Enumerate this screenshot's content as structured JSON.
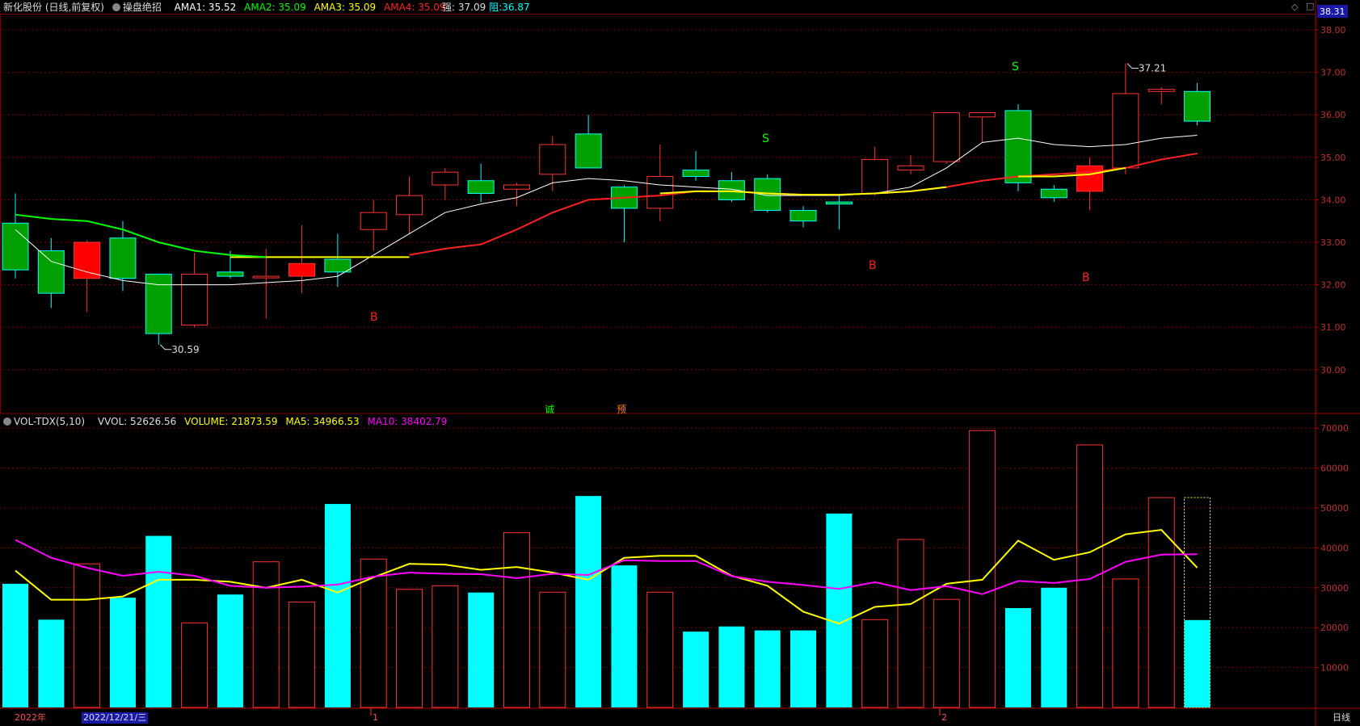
{
  "price_header": {
    "stock": "新化股份 (日线,前复权)",
    "indicator": "操盘绝招",
    "ama1": "AMA1: 35.52",
    "ama2": "AMA2: 35.09",
    "ama3": "AMA3: 35.09",
    "ama4": "AMA4: 35.09",
    "strong": "强: 37.09",
    "resist_label": "阻:",
    "resist_value": "36.87"
  },
  "vol_header": {
    "indicator": "VOL-TDX(5,10)",
    "vvol": "VVOL: 52626.56",
    "volume": "VOLUME: 21873.59",
    "ma5": "MA5: 34966.53",
    "ma10": "MA10: 38402.79"
  },
  "price_axis": {
    "current": "38.31",
    "ticks": [
      "38.00",
      "37.00",
      "36.00",
      "35.00",
      "34.00",
      "33.00",
      "32.00",
      "31.00",
      "30.00"
    ]
  },
  "volume_axis": {
    "ticks": [
      "70000",
      "60000",
      "50000",
      "40000",
      "30000",
      "20000",
      "10000"
    ]
  },
  "time_axis": {
    "year": "2022年",
    "selected_date": "2022/12/21/三",
    "month_marks": [
      "1",
      "2"
    ],
    "period": "日线"
  },
  "annotations": {
    "low": "30.59",
    "high": "37.21",
    "signals": [
      "B",
      "S",
      "B",
      "S",
      "B"
    ],
    "chars": [
      "诚",
      "预"
    ]
  },
  "colors": {
    "up": "#ff3232",
    "down": "#00a000",
    "volume_down": "#00ffff",
    "ma_white": "#ffffff",
    "ma_red": "#ff2020",
    "ma_yellow": "#ffff00",
    "ma_green": "#00ff00",
    "ma10": "#ff00ff",
    "grid": "#800000"
  },
  "chart_data": {
    "type": "candlestick",
    "candles": [
      {
        "o": 33.45,
        "h": 34.15,
        "l": 32.15,
        "c": 32.35
      },
      {
        "o": 32.8,
        "h": 33.1,
        "l": 31.45,
        "c": 31.8
      },
      {
        "o": 32.15,
        "h": 33.05,
        "l": 31.35,
        "c": 33.0
      },
      {
        "o": 33.1,
        "h": 33.5,
        "l": 31.85,
        "c": 32.15
      },
      {
        "o": 32.25,
        "h": 32.25,
        "l": 30.59,
        "c": 30.85
      },
      {
        "o": 31.05,
        "h": 32.75,
        "l": 31.0,
        "c": 32.25
      },
      {
        "o": 32.3,
        "h": 32.8,
        "l": 32.15,
        "c": 32.2
      },
      {
        "o": 32.2,
        "h": 32.85,
        "l": 31.2,
        "c": 32.2
      },
      {
        "o": 32.2,
        "h": 33.4,
        "l": 31.8,
        "c": 32.5
      },
      {
        "o": 32.6,
        "h": 33.2,
        "l": 31.95,
        "c": 32.3
      },
      {
        "o": 33.3,
        "h": 34.0,
        "l": 32.8,
        "c": 33.7
      },
      {
        "o": 33.65,
        "h": 34.55,
        "l": 33.2,
        "c": 34.1
      },
      {
        "o": 34.35,
        "h": 34.75,
        "l": 34.0,
        "c": 34.65
      },
      {
        "o": 34.45,
        "h": 34.85,
        "l": 33.95,
        "c": 34.15
      },
      {
        "o": 34.25,
        "h": 34.4,
        "l": 33.85,
        "c": 34.35
      },
      {
        "o": 34.6,
        "h": 35.5,
        "l": 34.2,
        "c": 35.3
      },
      {
        "o": 35.55,
        "h": 36.0,
        "l": 34.75,
        "c": 34.75
      },
      {
        "o": 34.3,
        "h": 34.35,
        "l": 33.0,
        "c": 33.8
      },
      {
        "o": 33.8,
        "h": 35.3,
        "l": 33.5,
        "c": 34.55
      },
      {
        "o": 34.7,
        "h": 35.15,
        "l": 34.45,
        "c": 34.55
      },
      {
        "o": 34.45,
        "h": 34.65,
        "l": 33.95,
        "c": 34.0
      },
      {
        "o": 34.5,
        "h": 34.6,
        "l": 33.7,
        "c": 33.75
      },
      {
        "o": 33.75,
        "h": 33.85,
        "l": 33.35,
        "c": 33.5
      },
      {
        "o": 33.95,
        "h": 34.1,
        "l": 33.3,
        "c": 33.9
      },
      {
        "o": 34.15,
        "h": 35.25,
        "l": 34.1,
        "c": 34.95
      },
      {
        "o": 34.7,
        "h": 35.05,
        "l": 34.6,
        "c": 34.8
      },
      {
        "o": 34.9,
        "h": 36.05,
        "l": 34.85,
        "c": 36.05
      },
      {
        "o": 35.95,
        "h": 36.05,
        "l": 35.35,
        "c": 36.05
      },
      {
        "o": 36.1,
        "h": 36.25,
        "l": 34.2,
        "c": 34.4
      },
      {
        "o": 34.25,
        "h": 34.35,
        "l": 33.95,
        "c": 34.05
      },
      {
        "o": 34.2,
        "h": 35.0,
        "l": 33.75,
        "c": 34.8
      },
      {
        "o": 34.75,
        "h": 37.21,
        "l": 34.6,
        "c": 36.5
      },
      {
        "o": 36.55,
        "h": 36.65,
        "l": 36.25,
        "c": 36.6
      },
      {
        "o": 36.55,
        "h": 36.75,
        "l": 35.75,
        "c": 35.85
      }
    ],
    "ma_white": [
      33.3,
      32.55,
      32.3,
      32.1,
      32.0,
      32.0,
      32.0,
      32.05,
      32.1,
      32.2,
      32.7,
      33.2,
      33.7,
      33.9,
      34.05,
      34.4,
      34.5,
      34.45,
      34.35,
      34.3,
      34.25,
      34.1,
      34.1,
      34.1,
      34.15,
      34.3,
      34.75,
      35.35,
      35.45,
      35.3,
      35.25,
      35.3,
      35.45,
      35.52
    ],
    "ma_red": [
      null,
      null,
      null,
      null,
      null,
      null,
      null,
      null,
      null,
      null,
      null,
      32.7,
      32.85,
      32.95,
      33.3,
      33.7,
      34.0,
      34.05,
      34.1,
      34.2,
      34.2,
      34.15,
      34.12,
      34.12,
      34.15,
      34.2,
      34.3,
      34.45,
      34.55,
      34.6,
      34.65,
      34.75,
      34.95,
      35.09
    ],
    "ma_yellow": [
      null,
      null,
      null,
      null,
      null,
      null,
      32.65,
      32.65,
      32.65,
      32.65,
      32.65,
      32.65,
      null,
      null,
      null,
      null,
      null,
      null,
      34.15,
      34.2,
      34.2,
      34.15,
      34.12,
      34.12,
      34.15,
      34.2,
      34.3,
      null,
      34.55,
      34.55,
      34.6,
      34.75,
      null,
      null
    ],
    "ma_green": [
      33.65,
      33.55,
      33.5,
      33.3,
      33.0,
      32.8,
      32.7,
      32.65,
      null,
      null,
      null,
      null,
      null,
      null,
      null,
      null,
      null,
      null,
      null,
      null,
      null,
      null,
      null,
      null,
      null,
      null,
      null,
      null,
      null,
      null,
      null,
      null,
      null,
      null
    ],
    "volume": [
      31000,
      22000,
      36000,
      27500,
      43000,
      21200,
      28300,
      36500,
      26400,
      51000,
      37200,
      29600,
      30500,
      28800,
      43800,
      28900,
      53000,
      35600,
      28900,
      19000,
      20300,
      19300,
      19300,
      48600,
      22000,
      42100,
      27100,
      69400,
      24900,
      30000,
      65800,
      32200,
      52600,
      21900
    ],
    "vol_ma5": [
      34300,
      27000,
      27000,
      27800,
      32000,
      32000,
      31500,
      30000,
      32000,
      28800,
      32600,
      36000,
      35800,
      34500,
      35200,
      33800,
      32000,
      37500,
      38000,
      38000,
      33000,
      30500,
      24000,
      21000,
      25200,
      25900,
      31000,
      32000,
      41800,
      37000,
      38900,
      43400,
      44500,
      35000
    ],
    "vol_ma10": [
      42000,
      37500,
      35000,
      33000,
      34000,
      33000,
      30500,
      30000,
      30300,
      30800,
      32800,
      33800,
      33500,
      33400,
      32400,
      33500,
      33200,
      36900,
      36700,
      36700,
      32900,
      31500,
      30700,
      29700,
      31400,
      29400,
      30400,
      28400,
      31700,
      31200,
      32200,
      36500,
      38300,
      38400
    ]
  }
}
